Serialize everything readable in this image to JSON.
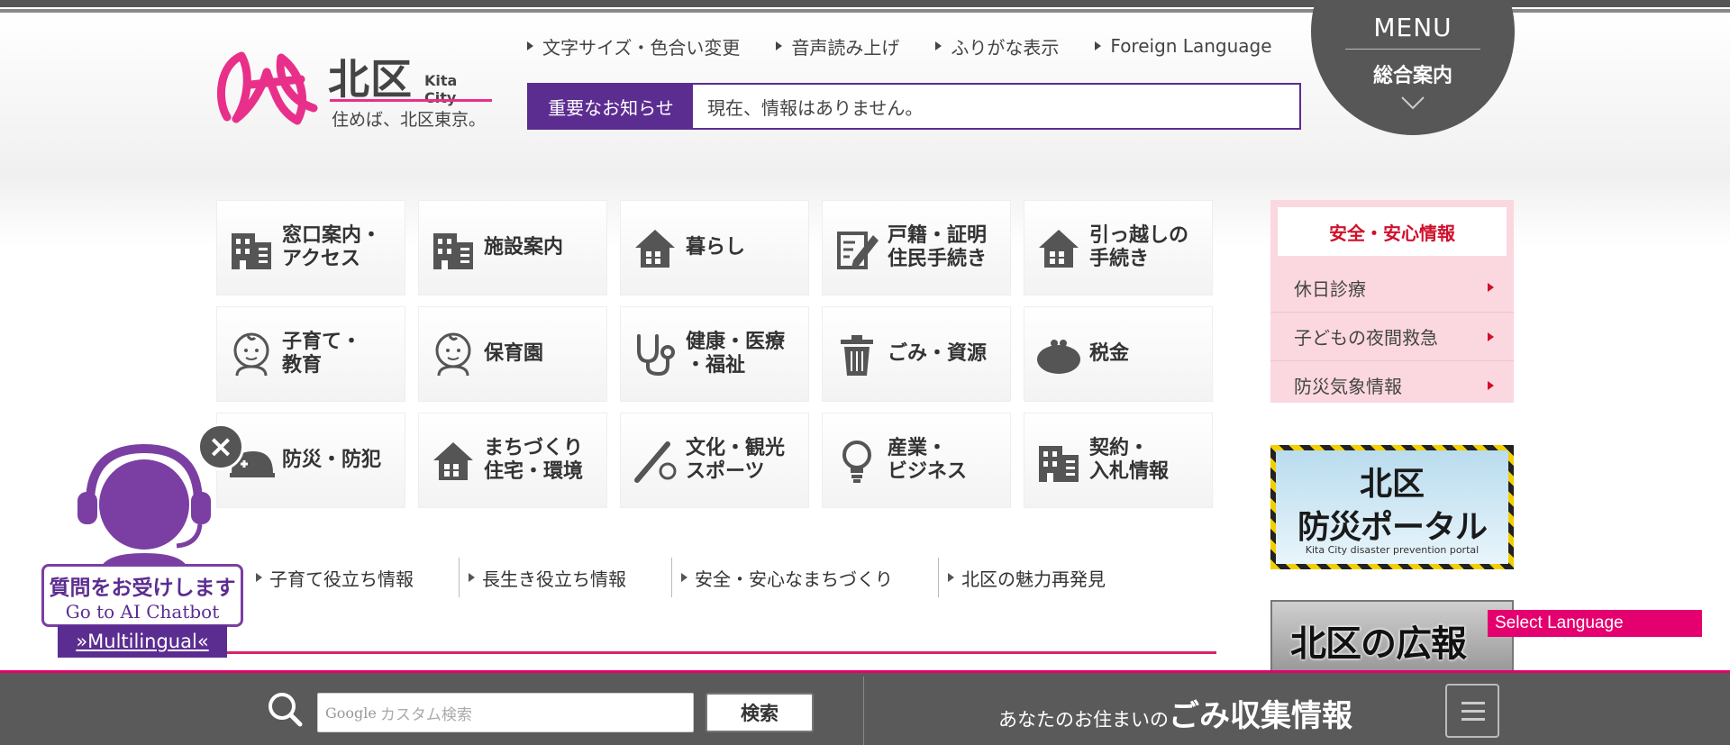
{
  "logo": {
    "title": "北区",
    "subtitle": "Kita City",
    "slogan": "住めば、北区東京。"
  },
  "utility_nav": [
    {
      "label": "文字サイズ・色合い変更"
    },
    {
      "label": "音声読み上げ"
    },
    {
      "label": "ふりがな表示"
    },
    {
      "label": "Foreign Language"
    }
  ],
  "notice": {
    "label": "重要なお知らせ",
    "text": "現在、情報はありません。"
  },
  "menu": {
    "title": "MENU",
    "subtitle": "総合案内"
  },
  "categories": [
    {
      "label": "窓口案内・\nアクセス",
      "icon": "building-icon"
    },
    {
      "label": "施設案内",
      "icon": "building-icon"
    },
    {
      "label": "暮らし",
      "icon": "house-icon"
    },
    {
      "label": "戸籍・証明\n住民手続き",
      "icon": "pen-document-icon"
    },
    {
      "label": "引っ越しの\n手続き",
      "icon": "house-icon"
    },
    {
      "label": "子育て・\n教育",
      "icon": "baby-icon"
    },
    {
      "label": "保育園",
      "icon": "baby-icon"
    },
    {
      "label": "健康・医療\n・福祉",
      "icon": "stethoscope-icon"
    },
    {
      "label": "ごみ・資源",
      "icon": "trash-icon"
    },
    {
      "label": "税金",
      "icon": "purse-icon"
    },
    {
      "label": "防災・防犯",
      "icon": "helmet-icon"
    },
    {
      "label": "まちづくり\n住宅・環境",
      "icon": "house-icon"
    },
    {
      "label": "文化・観光\nスポーツ",
      "icon": "baseball-icon"
    },
    {
      "label": "産業・\nビジネス",
      "icon": "lightbulb-icon"
    },
    {
      "label": "契約・\n入札情報",
      "icon": "building-icon"
    }
  ],
  "sub_links": [
    {
      "label": "子育て役立ち情報"
    },
    {
      "label": "長生き役立ち情報"
    },
    {
      "label": "安全・安心なまちづくり"
    },
    {
      "label": "北区の魅力再発見"
    }
  ],
  "safety": {
    "title": "安全・安心情報",
    "items": [
      {
        "label": "休日診療"
      },
      {
        "label": "子どもの夜間救急"
      },
      {
        "label": "防災気象情報"
      }
    ]
  },
  "banners": {
    "disaster_line1": "北区",
    "disaster_line2": "防災ポータル",
    "disaster_en": "Kita City disaster prevention portal",
    "koho": "北区の広報"
  },
  "select_language": "Select Language",
  "chatbot": {
    "question": "質問をお受けします",
    "go": "Go to AI Chatbot",
    "multilingual": "»Multilingual«"
  },
  "footer": {
    "search_google": "Google",
    "search_placeholder": "カスタム検索",
    "search_button": "検索",
    "gomi_prefix": "あなたのお住まいの",
    "gomi_main": "ごみ収集情報"
  },
  "colors": {
    "accent_purple": "#5c2d91",
    "accent_pink": "#e4006e",
    "safety_red": "#d0102b"
  }
}
